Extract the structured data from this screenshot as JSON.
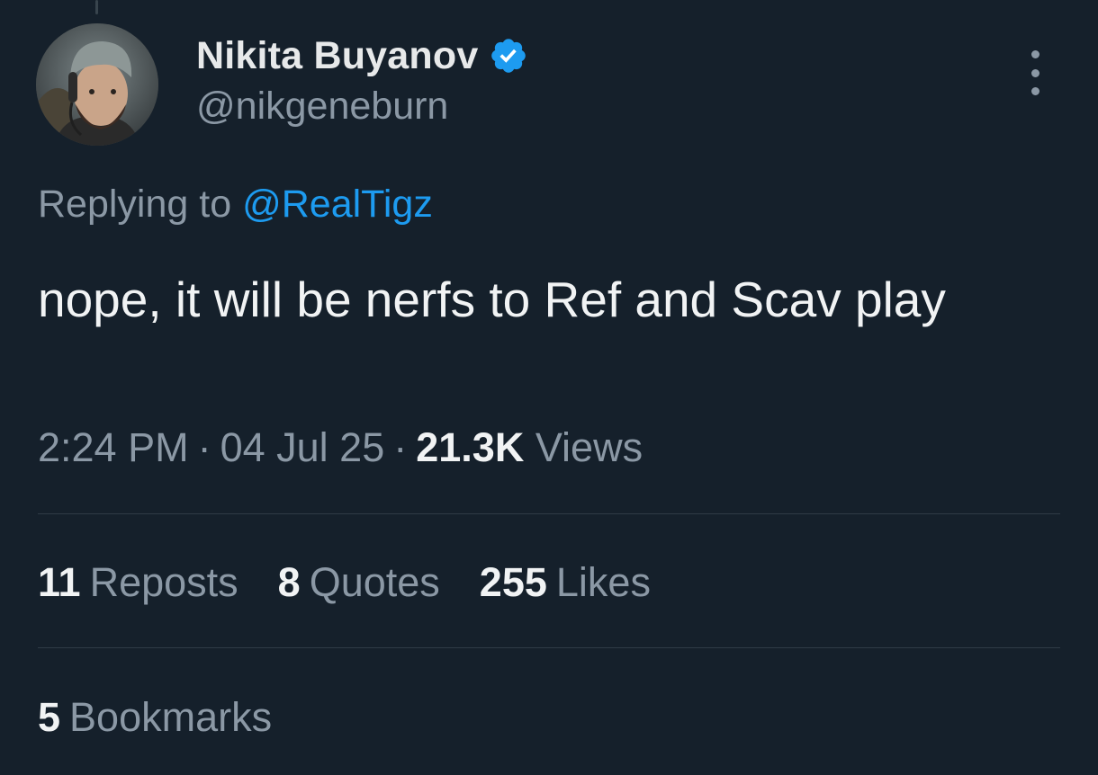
{
  "author": {
    "display_name": "Nikita Buyanov",
    "handle": "@nikgeneburn",
    "verified": true,
    "avatar_icon": "avatar-photo"
  },
  "reply": {
    "prefix": "Replying to",
    "mention": "@RealTigz"
  },
  "tweet": {
    "text": "nope, it will be nerfs to Ref and Scav play"
  },
  "meta": {
    "time": "2:24 PM",
    "separator": "·",
    "date": "04 Jul 25",
    "views_count": "21.3K",
    "views_label": "Views"
  },
  "stats": {
    "reposts_count": "11",
    "reposts_label": "Reposts",
    "quotes_count": "8",
    "quotes_label": "Quotes",
    "likes_count": "255",
    "likes_label": "Likes",
    "bookmarks_count": "5",
    "bookmarks_label": "Bookmarks"
  },
  "colors": {
    "background": "#15202b",
    "accent": "#1d9bf0",
    "text_primary": "#e7e9ea",
    "text_secondary": "#8b98a5",
    "divider": "#2f3b46"
  },
  "icons": {
    "verified": "verified-badge-icon",
    "more": "more-options-icon"
  }
}
